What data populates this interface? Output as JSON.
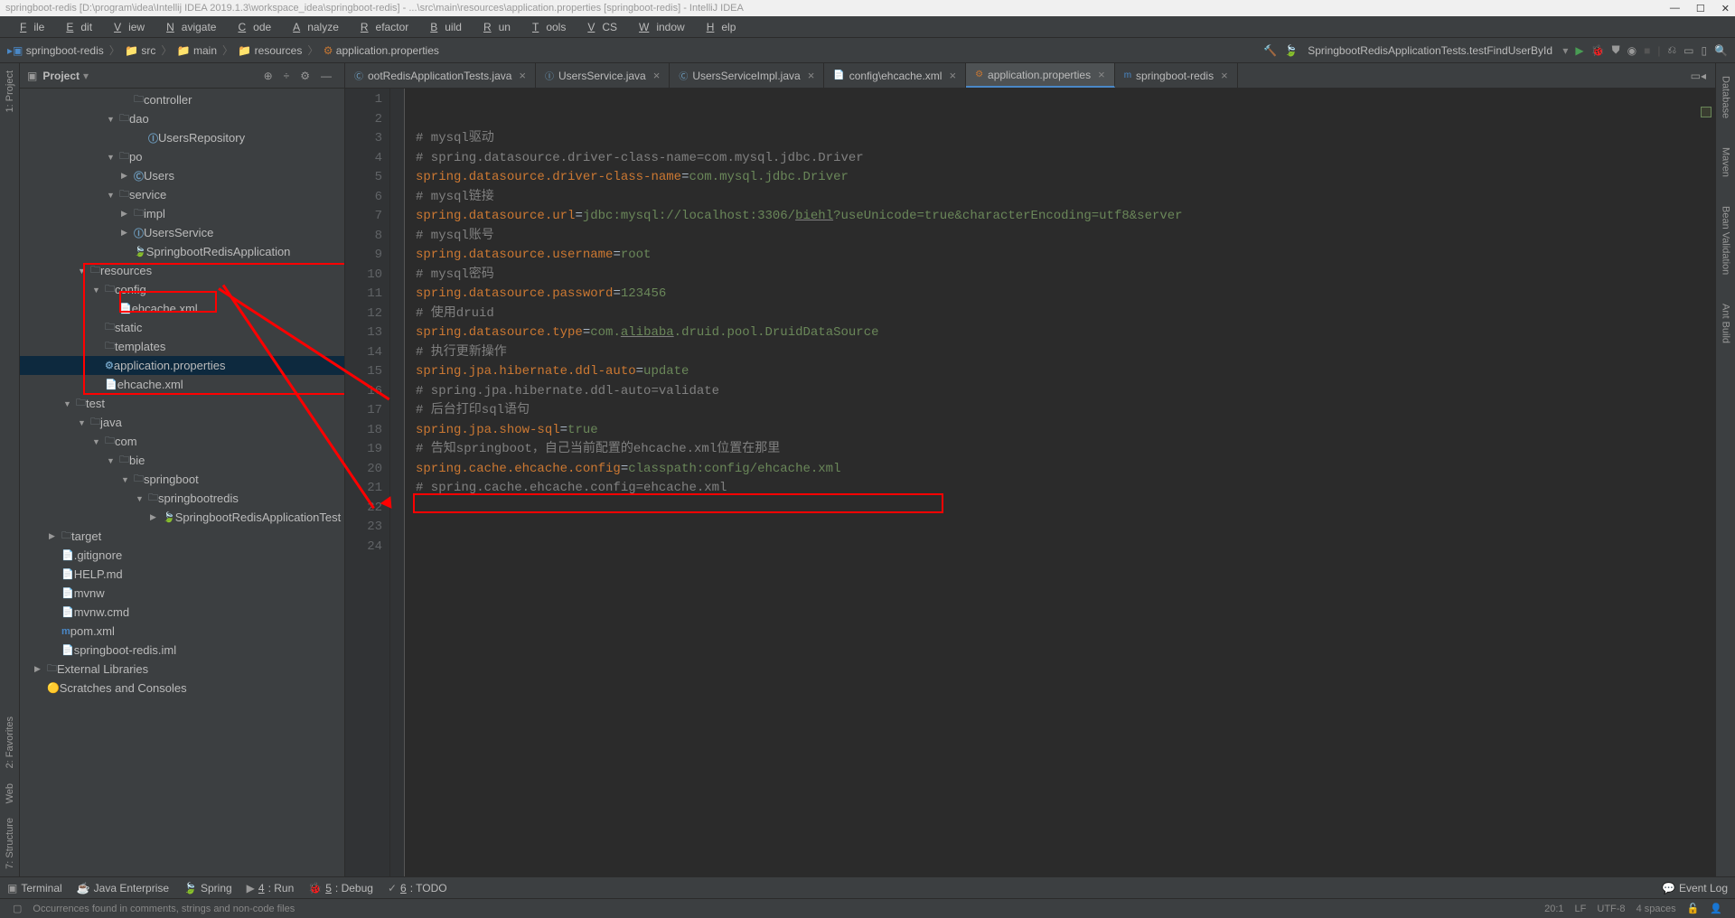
{
  "window": {
    "title": "springboot-redis [D:\\program\\idea\\Intellij IDEA 2019.1.3\\workspace_idea\\springboot-redis] - ...\\src\\main\\resources\\application.properties [springboot-redis] - IntelliJ IDEA"
  },
  "menu": [
    "File",
    "Edit",
    "View",
    "Navigate",
    "Code",
    "Analyze",
    "Refactor",
    "Build",
    "Run",
    "Tools",
    "VCS",
    "Window",
    "Help"
  ],
  "breadcrumb": {
    "items": [
      "springboot-redis",
      "src",
      "main",
      "resources",
      "application.properties"
    ]
  },
  "nav": {
    "run_config": "SpringbootRedisApplicationTests.testFindUserById",
    "dropdown_arrow": "▾"
  },
  "project_panel": {
    "title": "Project",
    "tree": [
      {
        "indent": 7,
        "arrow": "",
        "icon_cls": "icon-dir",
        "label": "controller"
      },
      {
        "indent": 6,
        "arrow": "▼",
        "icon_cls": "icon-dir",
        "label": "dao"
      },
      {
        "indent": 8,
        "arrow": "",
        "icon_cls": "icon-class",
        "label": "UsersRepository",
        "icon_txt": "Ⓘ"
      },
      {
        "indent": 6,
        "arrow": "▼",
        "icon_cls": "icon-dir",
        "label": "po"
      },
      {
        "indent": 7,
        "arrow": "▶",
        "icon_cls": "icon-class",
        "label": "Users",
        "icon_txt": "Ⓒ"
      },
      {
        "indent": 6,
        "arrow": "▼",
        "icon_cls": "icon-dir",
        "label": "service"
      },
      {
        "indent": 7,
        "arrow": "▶",
        "icon_cls": "icon-dir",
        "label": "impl"
      },
      {
        "indent": 7,
        "arrow": "▶",
        "icon_cls": "icon-class",
        "label": "UsersService",
        "icon_txt": "Ⓘ"
      },
      {
        "indent": 7,
        "arrow": "",
        "icon_cls": "icon-spring",
        "label": "SpringbootRedisApplication",
        "icon_txt": "🍃"
      },
      {
        "indent": 4,
        "arrow": "▼",
        "icon_cls": "icon-dir",
        "label": "resources"
      },
      {
        "indent": 5,
        "arrow": "▼",
        "icon_cls": "icon-dir",
        "label": "config"
      },
      {
        "indent": 6,
        "arrow": "",
        "icon_cls": "icon-xml",
        "label": "ehcache.xml",
        "icon_txt": "📄"
      },
      {
        "indent": 5,
        "arrow": "",
        "icon_cls": "icon-dir",
        "label": "static"
      },
      {
        "indent": 5,
        "arrow": "",
        "icon_cls": "icon-dir",
        "label": "templates"
      },
      {
        "indent": 5,
        "arrow": "",
        "icon_cls": "icon-prop",
        "label": "application.properties",
        "icon_txt": "⚙",
        "selected": true
      },
      {
        "indent": 5,
        "arrow": "",
        "icon_cls": "icon-xml",
        "label": "ehcache.xml",
        "icon_txt": "📄"
      },
      {
        "indent": 3,
        "arrow": "▼",
        "icon_cls": "icon-dir",
        "label": "test"
      },
      {
        "indent": 4,
        "arrow": "▼",
        "icon_cls": "icon-dir",
        "label": "java"
      },
      {
        "indent": 5,
        "arrow": "▼",
        "icon_cls": "icon-dir",
        "label": "com"
      },
      {
        "indent": 6,
        "arrow": "▼",
        "icon_cls": "icon-dir",
        "label": "bie"
      },
      {
        "indent": 7,
        "arrow": "▼",
        "icon_cls": "icon-dir",
        "label": "springboot"
      },
      {
        "indent": 8,
        "arrow": "▼",
        "icon_cls": "icon-dir",
        "label": "springbootredis"
      },
      {
        "indent": 9,
        "arrow": "▶",
        "icon_cls": "icon-spring",
        "label": "SpringbootRedisApplicationTest",
        "icon_txt": "🍃"
      },
      {
        "indent": 2,
        "arrow": "▶",
        "icon_cls": "icon-dir",
        "label": "target"
      },
      {
        "indent": 2,
        "arrow": "",
        "icon_cls": "icon-file",
        "label": ".gitignore",
        "icon_txt": "📄"
      },
      {
        "indent": 2,
        "arrow": "",
        "icon_cls": "icon-file",
        "label": "HELP.md",
        "icon_txt": "📄"
      },
      {
        "indent": 2,
        "arrow": "",
        "icon_cls": "icon-file",
        "label": "mvnw",
        "icon_txt": "📄"
      },
      {
        "indent": 2,
        "arrow": "",
        "icon_cls": "icon-file",
        "label": "mvnw.cmd",
        "icon_txt": "📄"
      },
      {
        "indent": 2,
        "arrow": "",
        "icon_cls": "icon-file",
        "label": "pom.xml",
        "icon_txt": "m",
        "icon_color": "#4a88c7"
      },
      {
        "indent": 2,
        "arrow": "",
        "icon_cls": "icon-file",
        "label": "springboot-redis.iml",
        "icon_txt": "📄"
      },
      {
        "indent": 1,
        "arrow": "▶",
        "icon_cls": "icon-dir",
        "label": "External Libraries",
        "icon_txt": "📚"
      },
      {
        "indent": 1,
        "arrow": "",
        "icon_cls": "icon-file",
        "label": "Scratches and Consoles",
        "icon_txt": "🟡"
      }
    ]
  },
  "tabs": [
    {
      "label": "ootRedisApplicationTests.java",
      "icon": "Ⓒ",
      "icon_color": "#6d9cbe"
    },
    {
      "label": "UsersService.java",
      "icon": "Ⓘ",
      "icon_color": "#6d9cbe"
    },
    {
      "label": "UsersServiceImpl.java",
      "icon": "Ⓒ",
      "icon_color": "#6d9cbe"
    },
    {
      "label": "config\\ehcache.xml",
      "icon": "📄",
      "icon_color": "#c57633"
    },
    {
      "label": "application.properties",
      "icon": "⚙",
      "icon_color": "#c57633",
      "active": true
    },
    {
      "label": "springboot-redis",
      "icon": "m",
      "icon_color": "#4a88c7"
    }
  ],
  "code_lines": [
    {
      "n": 1,
      "tokens": [
        {
          "cls": "c-comment",
          "txt": "# mysql驱动"
        }
      ]
    },
    {
      "n": 2,
      "tokens": [
        {
          "cls": "c-comment",
          "txt": "# spring.datasource.driver-class-name=com.mysql.jdbc.Driver"
        }
      ]
    },
    {
      "n": 3,
      "tokens": [
        {
          "cls": "c-key",
          "txt": "spring.datasource.driver-class-name"
        },
        {
          "cls": "",
          "txt": "="
        },
        {
          "cls": "c-val",
          "txt": "com.mysql.jdbc.Driver"
        }
      ]
    },
    {
      "n": 4,
      "tokens": [
        {
          "cls": "c-comment",
          "txt": "# mysql链接"
        }
      ]
    },
    {
      "n": 5,
      "tokens": [
        {
          "cls": "c-key",
          "txt": "spring.datasource.url"
        },
        {
          "cls": "",
          "txt": "="
        },
        {
          "cls": "c-val",
          "txt": "jdbc:mysql://localhost:3306/"
        },
        {
          "cls": "c-val c-underline",
          "txt": "biehl"
        },
        {
          "cls": "c-val",
          "txt": "?useUnicode=true&characterEncoding=utf8&server"
        }
      ]
    },
    {
      "n": 6,
      "tokens": [
        {
          "cls": "c-comment",
          "txt": "# mysql账号"
        }
      ]
    },
    {
      "n": 7,
      "tokens": [
        {
          "cls": "c-key",
          "txt": "spring.datasource.username"
        },
        {
          "cls": "",
          "txt": "="
        },
        {
          "cls": "c-val",
          "txt": "root"
        }
      ]
    },
    {
      "n": 8,
      "tokens": [
        {
          "cls": "c-comment",
          "txt": "# mysql密码"
        }
      ]
    },
    {
      "n": 9,
      "tokens": [
        {
          "cls": "c-key",
          "txt": "spring.datasource.password"
        },
        {
          "cls": "",
          "txt": "="
        },
        {
          "cls": "c-val",
          "txt": "123456"
        }
      ]
    },
    {
      "n": 10,
      "tokens": [
        {
          "cls": "",
          "txt": ""
        }
      ]
    },
    {
      "n": 11,
      "tokens": [
        {
          "cls": "c-comment",
          "txt": "# 使用druid"
        }
      ]
    },
    {
      "n": 12,
      "tokens": [
        {
          "cls": "c-key",
          "txt": "spring.datasource.type"
        },
        {
          "cls": "",
          "txt": "="
        },
        {
          "cls": "c-val",
          "txt": "com."
        },
        {
          "cls": "c-val c-underline",
          "txt": "alibaba"
        },
        {
          "cls": "c-val",
          "txt": ".druid.pool.DruidDataSource"
        }
      ]
    },
    {
      "n": 13,
      "tokens": [
        {
          "cls": "",
          "txt": ""
        }
      ]
    },
    {
      "n": 14,
      "tokens": [
        {
          "cls": "c-comment",
          "txt": "# 执行更新操作"
        }
      ]
    },
    {
      "n": 15,
      "tokens": [
        {
          "cls": "c-key",
          "txt": "spring.jpa.hibernate.ddl-auto"
        },
        {
          "cls": "",
          "txt": "="
        },
        {
          "cls": "c-val",
          "txt": "update"
        }
      ]
    },
    {
      "n": 16,
      "tokens": [
        {
          "cls": "c-comment",
          "txt": "# spring.jpa.hibernate.ddl-auto=validate"
        }
      ]
    },
    {
      "n": 17,
      "tokens": [
        {
          "cls": "",
          "txt": ""
        }
      ]
    },
    {
      "n": 18,
      "tokens": [
        {
          "cls": "c-comment",
          "txt": "# 后台打印sql语句"
        }
      ]
    },
    {
      "n": 19,
      "tokens": [
        {
          "cls": "c-key",
          "txt": "spring.jpa.show-sql"
        },
        {
          "cls": "",
          "txt": "="
        },
        {
          "cls": "c-val",
          "txt": "true"
        }
      ]
    },
    {
      "n": 20,
      "tokens": [
        {
          "cls": "",
          "txt": ""
        }
      ],
      "caret": true
    },
    {
      "n": 21,
      "tokens": [
        {
          "cls": "c-comment",
          "txt": "# 告知springboot，自己当前配置的ehcache.xml位置在那里"
        }
      ]
    },
    {
      "n": 22,
      "tokens": [
        {
          "cls": "c-key",
          "txt": "spring.cache.ehcache.config"
        },
        {
          "cls": "",
          "txt": "="
        },
        {
          "cls": "c-val",
          "txt": "classpath:config/ehcache.xml"
        }
      ]
    },
    {
      "n": 23,
      "tokens": [
        {
          "cls": "c-comment",
          "txt": "# spring.cache.ehcache.config=ehcache.xml"
        }
      ]
    },
    {
      "n": 24,
      "tokens": [
        {
          "cls": "",
          "txt": ""
        }
      ]
    }
  ],
  "left_gutter": [
    "1: Project",
    "2: Favorites",
    "Web",
    "7: Structure"
  ],
  "right_gutter": [
    "Database",
    "Maven",
    "Bean Validation",
    "Ant Build"
  ],
  "bottom_toolbar": {
    "items": [
      "Terminal",
      "Java Enterprise",
      "Spring",
      "4: Run",
      "5: Debug",
      "6: TODO"
    ],
    "event_log": "Event Log"
  },
  "status": {
    "msg": "Occurrences found in comments, strings and non-code files",
    "pos": "20:1",
    "sep": "LF",
    "enc": "UTF-8",
    "indent": "4 spaces"
  }
}
